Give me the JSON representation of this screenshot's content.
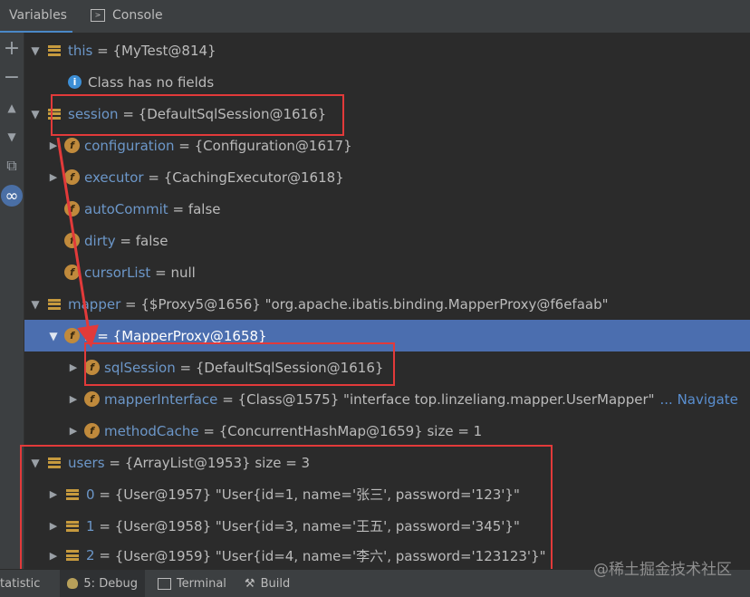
{
  "tabs": {
    "variables": "Variables",
    "console": "Console"
  },
  "toolstrip": {
    "add": "+",
    "remove": "−",
    "up": "▲",
    "down": "▼",
    "copy": "⧉",
    "watch": "∞"
  },
  "rows": [
    {
      "name": "this",
      "value": "{MyTest@814}"
    },
    {
      "text": "Class has no fields"
    },
    {
      "name": "session",
      "value": "{DefaultSqlSession@1616}"
    },
    {
      "name": "configuration",
      "value": "{Configuration@1617}"
    },
    {
      "name": "executor",
      "value": "{CachingExecutor@1618}"
    },
    {
      "name": "autoCommit",
      "value": "false"
    },
    {
      "name": "dirty",
      "value": "false"
    },
    {
      "name": "cursorList",
      "value": "null"
    },
    {
      "name": "mapper",
      "value": "{$Proxy5@1656} \"org.apache.ibatis.binding.MapperProxy@f6efaab\""
    },
    {
      "name": "h",
      "value": "{MapperProxy@1658}"
    },
    {
      "name": "sqlSession",
      "value": "{DefaultSqlSession@1616}"
    },
    {
      "name": "mapperInterface",
      "value": "{Class@1575} \"interface top.linzeliang.mapper.UserMapper\"",
      "link": "... Navigate"
    },
    {
      "name": "methodCache",
      "value": "{ConcurrentHashMap@1659}  size = 1"
    },
    {
      "name": "users",
      "value": "{ArrayList@1953}  size = 3"
    },
    {
      "name": "0",
      "value": "{User@1957} \"User{id=1, name='张三', password='123'}\""
    },
    {
      "name": "1",
      "value": "{User@1958} \"User{id=3, name='王五', password='345'}\""
    },
    {
      "name": "2",
      "value": "{User@1959} \"User{id=4, name='李六', password='123123'}\""
    }
  ],
  "eq": "=",
  "icon_letter": "f",
  "info_letter": "i",
  "statusbar": {
    "statistic": "tatistic",
    "debug": "5: Debug",
    "terminal": "Terminal",
    "build": "Build"
  },
  "watermark": "@稀土掘金技术社区",
  "colors": {
    "highlight": "#e23a3a",
    "selected_row": "#4b6eaf",
    "var_name": "#6c97c9"
  }
}
